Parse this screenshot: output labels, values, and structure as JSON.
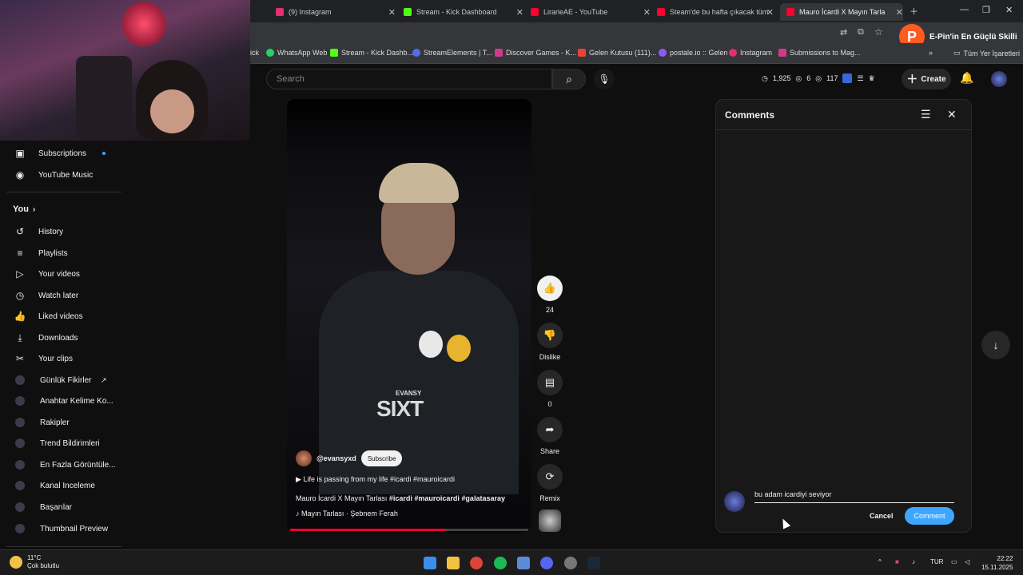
{
  "browser": {
    "tabs": [
      {
        "title": "(9) Instagram",
        "color": "#e1306c"
      },
      {
        "title": "Stream - Kick Dashboard",
        "color": "#53fc18"
      },
      {
        "title": "LirarieAE - YouTube",
        "color": "#ff0033"
      },
      {
        "title": "Steam'de bu hafta çıkacak tüm",
        "color": "#ff0033"
      },
      {
        "title": "Mauro İcardi X Mayın Tarla",
        "color": "#ff0033"
      }
    ],
    "bookmarks": [
      {
        "label": "ick",
        "color": "#53fc18"
      },
      {
        "label": "WhatsApp Web",
        "color": "#25d366"
      },
      {
        "label": "Stream - Kick Dashb...",
        "color": "#53fc18"
      },
      {
        "label": "StreamElements | T...",
        "color": "#4c6ef5"
      },
      {
        "label": "Discover Games - K...",
        "color": "#d03a8a"
      },
      {
        "label": "Gelen Kutusu (111)...",
        "color": "#ea4335"
      },
      {
        "label": "postale.io :: Gelen",
        "color": "#8b5cf6"
      },
      {
        "label": "Instagram",
        "color": "#e1306c"
      },
      {
        "label": "Submissions to Mag...",
        "color": "#d03a8a"
      }
    ],
    "all_bookmarks": "Tüm Yer İşaretleri",
    "promo": "E-Pin'in En Güçlü Skilli"
  },
  "youtube": {
    "search_placeholder": "Search",
    "stats": {
      "views": "1,925",
      "a": "6",
      "b": "117"
    },
    "create_label": "Create",
    "sidebar": {
      "top": [
        {
          "label": "Subscriptions",
          "icon": "subscriptions-icon",
          "glyph": "▣"
        },
        {
          "label": "YouTube Music",
          "icon": "music-icon",
          "glyph": "◉"
        }
      ],
      "you_heading": "You",
      "you": [
        {
          "label": "History",
          "icon": "history-icon",
          "glyph": "↺"
        },
        {
          "label": "Playlists",
          "icon": "playlists-icon",
          "glyph": "≡"
        },
        {
          "label": "Your videos",
          "icon": "your-videos-icon",
          "glyph": "▷"
        },
        {
          "label": "Watch later",
          "icon": "watch-later-icon",
          "glyph": "◷"
        },
        {
          "label": "Liked videos",
          "icon": "liked-icon",
          "glyph": "👍"
        },
        {
          "label": "Downloads",
          "icon": "downloads-icon",
          "glyph": "⤓"
        },
        {
          "label": "Your clips",
          "icon": "clips-icon",
          "glyph": "✂"
        }
      ],
      "tools": [
        "Günlük Fikirler",
        "Anahtar Kelime Ko...",
        "Rakipler",
        "Trend Bildirimleri",
        "En Fazla Görüntüle...",
        "Kanal Inceleme",
        "Başarılar",
        "Thumbnail Preview"
      ]
    },
    "short": {
      "overlay_small": "EVANSY",
      "overlay_big": "SIXT",
      "channel": "@evansyxd",
      "subscribe": "Subscribe",
      "line1": "Life is passing from my life #icardi #mauroicardi",
      "line2_plain": "Mauro İcardi X Mayın Tarlası ",
      "line2_tags": "#icardi #mauroicardi #galatasaray",
      "music": "Mayın Tarlası · Şebnem Ferah",
      "progress": 0.65
    },
    "actions": {
      "likes": "24",
      "dislike": "Dislike",
      "comments": "0",
      "share": "Share",
      "remix": "Remix"
    },
    "comments_panel": {
      "title": "Comments",
      "draft": "bu adam icardiyi seviyor",
      "cancel": "Cancel",
      "submit": "Comment"
    }
  },
  "taskbar": {
    "temp": "11°C",
    "weather": "Çok bulutlu",
    "lang": "TUR",
    "time": "22:22",
    "date": "15.11.2025"
  }
}
